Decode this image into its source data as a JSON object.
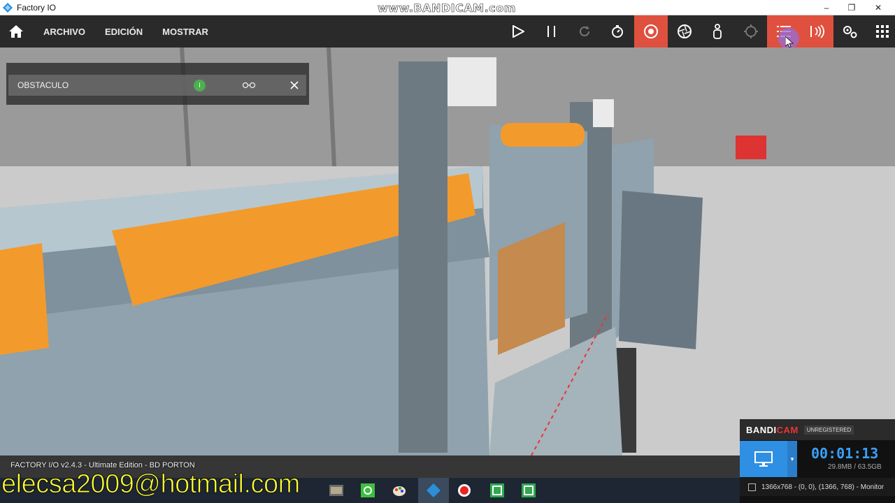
{
  "window": {
    "title": "Factory IO",
    "watermark": "www.BANDICAM.com",
    "minimize": "–",
    "maximize": "❐",
    "close": "✕"
  },
  "toolbar": {
    "menu": [
      "ARCHIVO",
      "EDICIÓN",
      "MOSTRAR"
    ],
    "accent_color": "#e0503f"
  },
  "panel": {
    "label": "OBSTACULO",
    "badge": "I"
  },
  "status": {
    "text": "FACTORY I/O v2.4.3 - Ultimate Edition - BD PORTON"
  },
  "overlay": {
    "email": "elecsa2009@hotmail.com"
  },
  "bandicam": {
    "brand_a": "BANDI",
    "brand_b": "CAM",
    "unregistered": "UNREGISTERED",
    "time": "00:01:13",
    "size": "29.8MB / 63.5GB",
    "region": "1366x768 - (0, 0), (1366, 768) - Monitor"
  }
}
